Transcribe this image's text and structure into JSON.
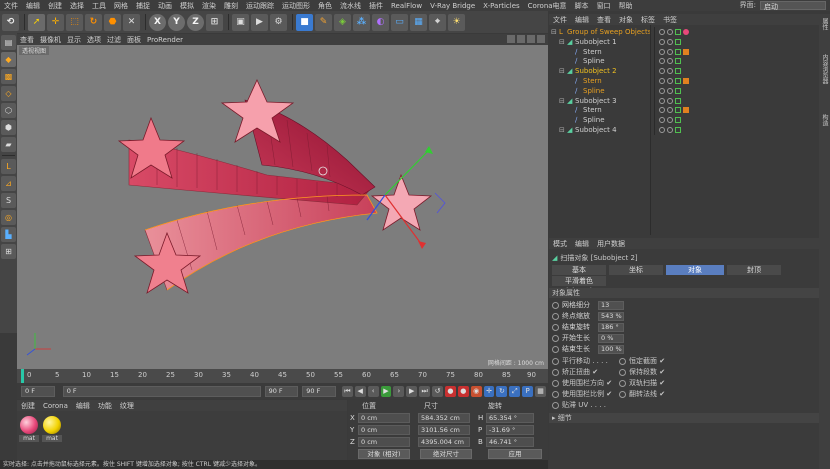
{
  "menubar": {
    "items": [
      "文件",
      "编辑",
      "创建",
      "选择",
      "工具",
      "网格",
      "捕捉",
      "动画",
      "模拟",
      "渲染",
      "雕刻",
      "运动跟踪",
      "运动图形",
      "角色",
      "流水线",
      "插件",
      "RealFlow",
      "V-Ray Bridge",
      "X-Particles",
      "Corona电意",
      "脚本",
      "窗口",
      "帮助"
    ],
    "layout_label": "界面:",
    "layout_value": "启动"
  },
  "toolbar": {
    "axes": [
      "X",
      "Y",
      "Z"
    ]
  },
  "viewport_menu": {
    "items": [
      "查看",
      "摄像机",
      "显示",
      "选项",
      "过滤",
      "面板",
      "ProRender"
    ]
  },
  "viewport": {
    "label": "透视视图",
    "grid_label": "网格间距 : 1000 cm"
  },
  "timeline": {
    "ticks": [
      "0",
      "5",
      "10",
      "15",
      "20",
      "25",
      "30",
      "35",
      "40",
      "45",
      "50",
      "55",
      "60",
      "65",
      "70",
      "75",
      "80",
      "85",
      "90"
    ],
    "current_frame": "0 F",
    "start_frame": "0 F",
    "end_frame": "90 F",
    "end_frame2": "90 F"
  },
  "material_panel": {
    "menu": [
      "创建",
      "Corona",
      "编辑",
      "功能",
      "纹理"
    ],
    "materials": [
      {
        "name": "mat",
        "color": "#e8487a"
      },
      {
        "name": "mat",
        "color": "#f2d200"
      }
    ]
  },
  "coord_panel": {
    "headers": [
      "位置",
      "尺寸",
      "旋转"
    ],
    "rows": [
      {
        "axis": "X",
        "pos": "0 cm",
        "size": "584.352 cm",
        "rot_axis": "H",
        "rot": "65.354 °"
      },
      {
        "axis": "Y",
        "pos": "0 cm",
        "size": "3101.56 cm",
        "rot_axis": "P",
        "rot": "-31.69 °"
      },
      {
        "axis": "Z",
        "pos": "0 cm",
        "size": "4395.004 cm",
        "rot_axis": "B",
        "rot": "46.741 °"
      }
    ],
    "mode1": "对象 (相对)",
    "mode2": "绝对尺寸",
    "apply": "应用"
  },
  "statusbar": {
    "text": "实时选择: 点击并拖动鼠标选择元素。按住 SHIFT 键增加选择对象; 按住 CTRL 键减少选择对象。"
  },
  "object_manager": {
    "menu": [
      "文件",
      "编辑",
      "查看",
      "对象",
      "标签",
      "书签"
    ],
    "objects": [
      {
        "name": "Group of Sweep Objects",
        "indent": 0,
        "color": "#e8a020"
      },
      {
        "name": "Subobject 1",
        "indent": 1,
        "color": "#d0d0d0"
      },
      {
        "name": "Stern",
        "indent": 2,
        "color": "#d0d0d0"
      },
      {
        "name": "Spline",
        "indent": 2,
        "color": "#d0d0d0"
      },
      {
        "name": "Subobject 2",
        "indent": 1,
        "color": "#f0c020"
      },
      {
        "name": "Stern",
        "indent": 2,
        "color": "#e8a020"
      },
      {
        "name": "Spline",
        "indent": 2,
        "color": "#e8a020"
      },
      {
        "name": "Subobject 3",
        "indent": 1,
        "color": "#d0d0d0"
      },
      {
        "name": "Stern",
        "indent": 2,
        "color": "#d0d0d0"
      },
      {
        "name": "Spline",
        "indent": 2,
        "color": "#d0d0d0"
      },
      {
        "name": "Subobject 4",
        "indent": 1,
        "color": "#d0d0d0"
      }
    ]
  },
  "attributes": {
    "menu": [
      "模式",
      "编辑",
      "用户数据"
    ],
    "title": "扫描对象 [Subobject 2]",
    "tabs": [
      "基本",
      "坐标",
      "对象",
      "封顶"
    ],
    "active_tab": "对象",
    "phong": "平滑着色(Phong)",
    "section": "对象属性",
    "fields": [
      {
        "label": "网格细分",
        "value": "13"
      },
      {
        "label": "终点缩放",
        "value": "543 %"
      },
      {
        "label": "结束旋转",
        "value": "186 °"
      },
      {
        "label": "开始生长",
        "value": "0 %"
      },
      {
        "label": "结束生长",
        "value": "100 %"
      }
    ],
    "checks_left": [
      "平行移动 . . . .",
      "矫正扭曲 ✔",
      "使用围栏方向 ✔",
      "使用围栏比例 ✔",
      "贴滞 UV . . . ."
    ],
    "checks_right": [
      "恒定截面 ✔",
      "保持段数 ✔",
      "双轨扫描 ✔",
      "翻转法线 ✔"
    ],
    "subsection": "▸ 细节"
  },
  "right_tabs": [
    "属性",
    "内容浏览器",
    "构造"
  ]
}
